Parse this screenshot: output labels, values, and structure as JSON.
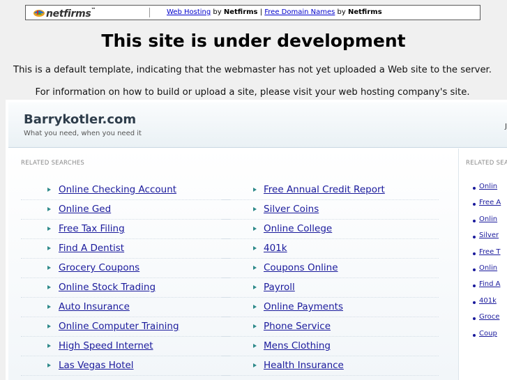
{
  "banner": {
    "logo_text": "netfirms",
    "links": [
      {
        "link": "Web Hosting",
        "by": "by",
        "brand": "Netfirms"
      },
      {
        "link": "Free Domain Names",
        "by": "by",
        "brand": "Netfirms"
      }
    ],
    "separator": "|"
  },
  "notice": {
    "title": "This site is under development",
    "line1": "This is a default template, indicating that the webmaster has not yet uploaded a Web site to the server.",
    "line2": "For information on how to build or upload a site, please visit your web hosting company's site."
  },
  "parked": {
    "site_name": "Barrykotler.com",
    "tagline": "What you need, when you need it",
    "header_right_fragment": "Ju",
    "related_label": "RELATED SEARCHES",
    "related_label_right": "RELATED SEA",
    "left_links": [
      "Online Checking Account",
      "Online Ged",
      "Free Tax Filing",
      "Find A Dentist",
      "Grocery Coupons",
      "Online Stock Trading",
      "Auto Insurance",
      "Online Computer Training",
      "High Speed Internet",
      "Las Vegas Hotel"
    ],
    "right_links": [
      "Free Annual Credit Report",
      "Silver Coins",
      "Online College",
      "401k",
      "Coupons Online",
      "Payroll",
      "Online Payments",
      "Phone Service",
      "Mens Clothing",
      "Health Insurance"
    ],
    "side_links": [
      "Onlin",
      "Free A",
      "Onlin",
      "Silver",
      "Free T",
      "Onlin",
      "Find A",
      "401k",
      "Groce",
      "Coup"
    ]
  },
  "colors": {
    "link": "#1a1a9c",
    "arrow": "#2f8a8a",
    "page_bg": "#f0f0f0"
  }
}
